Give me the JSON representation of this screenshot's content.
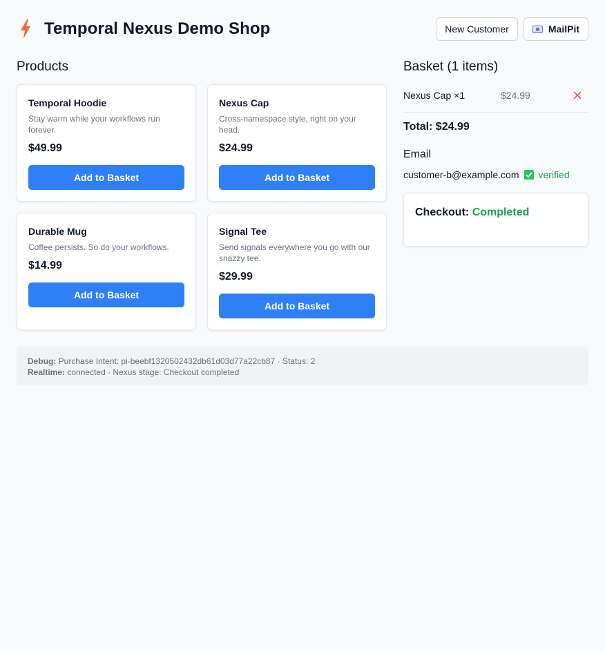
{
  "header": {
    "title": "Temporal Nexus Demo Shop",
    "new_customer_label": "New Customer",
    "mailpit_label": "MailPit",
    "accent_color": "#f26b3a"
  },
  "products": {
    "title": "Products",
    "items": [
      {
        "name": "Temporal Hoodie",
        "description": "Stay warm while your workflows run forever.",
        "price": "$49.99",
        "button": "Add to Basket"
      },
      {
        "name": "Nexus Cap",
        "description": "Cross-namespace style, right on your head.",
        "price": "$24.99",
        "button": "Add to Basket"
      },
      {
        "name": "Durable Mug",
        "description": "Coffee persists. So do your workflows.",
        "price": "$14.99",
        "button": "Add to Basket"
      },
      {
        "name": "Signal Tee",
        "description": "Send signals everywhere you go with our snazzy tee.",
        "price": "$29.99",
        "button": "Add to Basket"
      }
    ],
    "button_color": "#2f80f7"
  },
  "basket": {
    "title": "Basket (1 items)",
    "items": [
      {
        "label": "Nexus Cap ×1",
        "price": "$24.99"
      }
    ],
    "total": "Total: $24.99",
    "email_title": "Email",
    "email": "customer-b@example.com",
    "verified_label": "verified",
    "checkout_label": "Checkout:",
    "checkout_status": "Completed",
    "status_color": "#16a34a"
  },
  "debug": {
    "debug_label": "Debug:",
    "debug_text": "Purchase Intent: pi-beebf1320502432db61d03d77a22cb87 · Status: 2",
    "realtime_label": "Realtime:",
    "realtime_text": "connected · Nexus stage: Checkout completed"
  }
}
